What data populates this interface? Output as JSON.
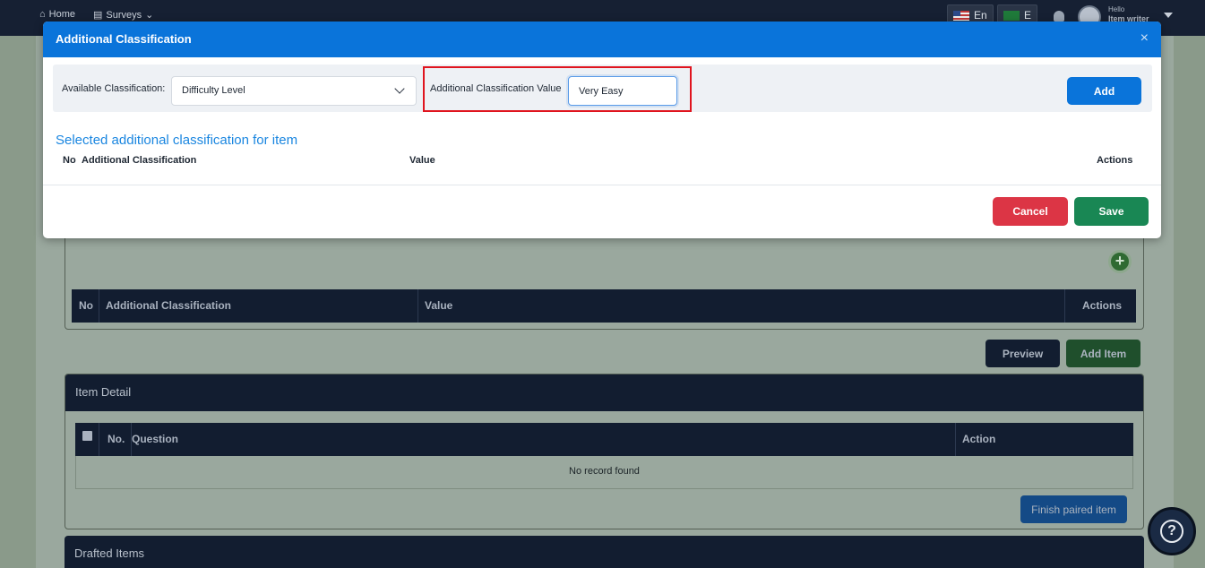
{
  "nav": {
    "home_label": "Home",
    "surveys_label": "Surveys",
    "lang_en": "En",
    "lang_other": "E",
    "user_greeting": "Hello",
    "user_name": "Item writer"
  },
  "background": {
    "classification_table": {
      "columns": [
        "No",
        "Additional Classification",
        "Value",
        "Actions"
      ]
    },
    "preview_label": "Preview",
    "add_item_label": "Add Item",
    "item_detail": {
      "title": "Item Detail",
      "columns": [
        "No.",
        "Question",
        "Action"
      ],
      "empty_text": "No record found",
      "finish_paired_label": "Finish paired item"
    },
    "drafted_items_title": "Drafted Items"
  },
  "modal": {
    "title": "Additional Classification",
    "close_symbol": "×",
    "available_label": "Available Classification:",
    "available_value": "Difficulty Level",
    "value_label": "Additional Classification Value",
    "value_input": "Very Easy",
    "add_label": "Add",
    "selected_title": "Selected additional classification for item",
    "columns": [
      "No",
      "Additional Classification",
      "Value",
      "Actions"
    ],
    "cancel_label": "Cancel",
    "save_label": "Save"
  },
  "colors": {
    "primary": "#0a74da",
    "danger": "#dc3545",
    "success": "#198754",
    "navy": "#162033",
    "highlight": "#e0141e"
  },
  "icons": [
    "home-icon",
    "surveys-icon",
    "chevron-down-icon",
    "flag-us-icon",
    "flag-sa-icon",
    "bell-icon",
    "avatar",
    "caret-down-icon",
    "close-icon",
    "plus-icon",
    "help-icon"
  ]
}
